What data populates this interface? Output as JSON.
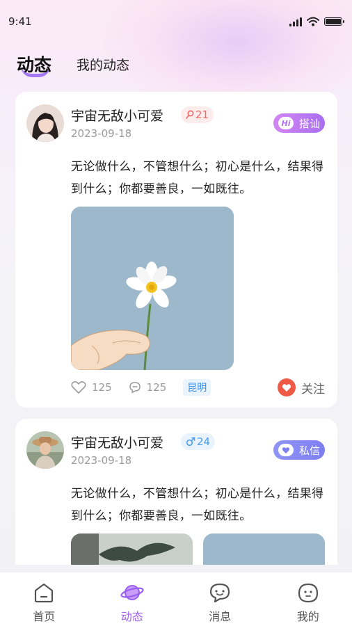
{
  "status_bar": {
    "time": "9:41"
  },
  "header": {
    "tabs": [
      {
        "label": "动态",
        "active": true
      },
      {
        "label": "我的动态",
        "active": false
      }
    ]
  },
  "posts": [
    {
      "username": "宇宙无敌小可爱",
      "gender": "female",
      "age": "21",
      "date": "2023-09-18",
      "action": {
        "label": "搭讪",
        "icon_text": "Hi",
        "icon": "hi-icon"
      },
      "text": "无论做什么，不管想什么；初心是什么，结果得到什么；你都要善良，一如既往。",
      "likes": "125",
      "comments": "125",
      "location": "昆明",
      "follow_label": "关注"
    },
    {
      "username": "宇宙无敌小可爱",
      "gender": "male",
      "age": "24",
      "date": "2023-09-18",
      "action": {
        "label": "私信",
        "icon": "heart-icon"
      },
      "text": "无论做什么，不管想什么；初心是什么，结果得到什么；你都要善良，一如既往。"
    }
  ],
  "bottom_nav": [
    {
      "label": "首页",
      "icon": "home-icon",
      "active": false
    },
    {
      "label": "动态",
      "icon": "planet-icon",
      "active": true
    },
    {
      "label": "消息",
      "icon": "chat-bubble-icon",
      "active": false
    },
    {
      "label": "我的",
      "icon": "face-icon",
      "active": false
    }
  ],
  "colors": {
    "accent_purple": "#a264f0",
    "female_badge": "#f06a6a",
    "male_badge": "#4da0ee",
    "follow_red": "#ee5a45",
    "location_blue": "#3d8fe8"
  }
}
